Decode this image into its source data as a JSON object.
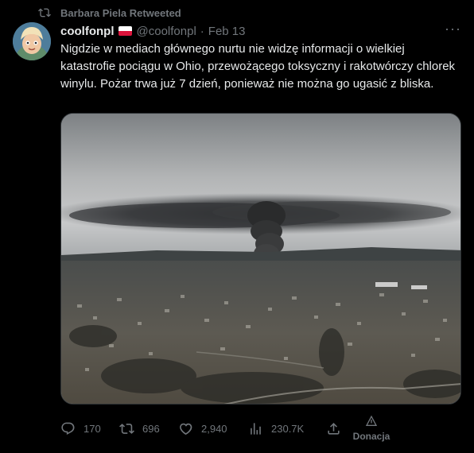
{
  "retweet": {
    "text": "Barbara Piela Retweeted"
  },
  "author": {
    "display_name": "coolfonpl",
    "handle": "@coolfonpl",
    "separator": "·",
    "date": "Feb 13",
    "flag": "poland-flag"
  },
  "tweet": {
    "text": "Nigdzie w mediach głównego nurtu nie widzę informacji o wielkiej katastrofie pociągu w Ohio, przewożącego toksyczny i rakotwórczy chlorek winylu. Pożar trwa już 7 dzień, ponieważ nie można go ugasić z bliska."
  },
  "actions": {
    "replies": "170",
    "retweets": "696",
    "likes": "2,940",
    "views": "230.7K",
    "donate_label": "Donacja"
  },
  "icons": {
    "retweet": "retweet-icon",
    "more": "more-icon",
    "reply": "reply-icon",
    "like": "heart-icon",
    "views": "views-icon",
    "share": "share-icon",
    "donate": "donate-icon"
  },
  "colors": {
    "background": "#000000",
    "text": "#e7e9ea",
    "muted": "#71767b",
    "border": "#2f3336"
  }
}
